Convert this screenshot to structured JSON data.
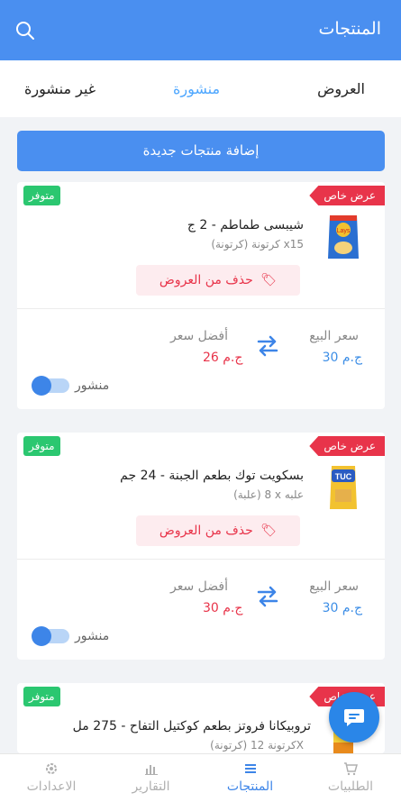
{
  "header": {
    "title": "المنتجات"
  },
  "tabs": [
    {
      "label": "العروض"
    },
    {
      "label": "منشورة"
    },
    {
      "label": "غير منشورة"
    }
  ],
  "add_button": {
    "label": "إضافة منتجات جديدة"
  },
  "products": [
    {
      "offer_badge": "عرض خاص",
      "availability": "متوفر",
      "name": "شيبسى طماطم - 2 ج",
      "description": "(كرتونة) كرتونة x15",
      "remove_label": "حذف من العروض",
      "sell_price_label": "سعر البيع",
      "sell_price": "30 ج.م",
      "best_price_label": "أفضل سعر",
      "best_price": "26 ج.م",
      "published_label": "منشور",
      "published": true
    },
    {
      "offer_badge": "عرض خاص",
      "availability": "متوفر",
      "name": "بسكويت توك بطعم الجبنة - 24 جم",
      "description": "(علبة) 8 x علبه",
      "remove_label": "حذف من العروض",
      "sell_price_label": "سعر البيع",
      "sell_price": "30 ج.م",
      "best_price_label": "أفضل سعر",
      "best_price": "30 ج.م",
      "published_label": "منشور",
      "published": true
    },
    {
      "offer_badge": "عرض خاص",
      "availability": "متوفر",
      "name": "تروبيكانا فروتز بطعم كوكتيل التفاح - 275 مل",
      "description": "(كرتونة) كرتونة 12X"
    }
  ],
  "bottom_nav": [
    {
      "label": "الطلبيات",
      "icon": "cart-icon"
    },
    {
      "label": "المنتجات",
      "icon": "menu-icon"
    },
    {
      "label": "التقارير",
      "icon": "chart-icon"
    },
    {
      "label": "الاعدادات",
      "icon": "gear-icon"
    }
  ],
  "colors": {
    "primary": "#4a8ff0",
    "offer": "#e8344a",
    "available": "#2bc770"
  }
}
